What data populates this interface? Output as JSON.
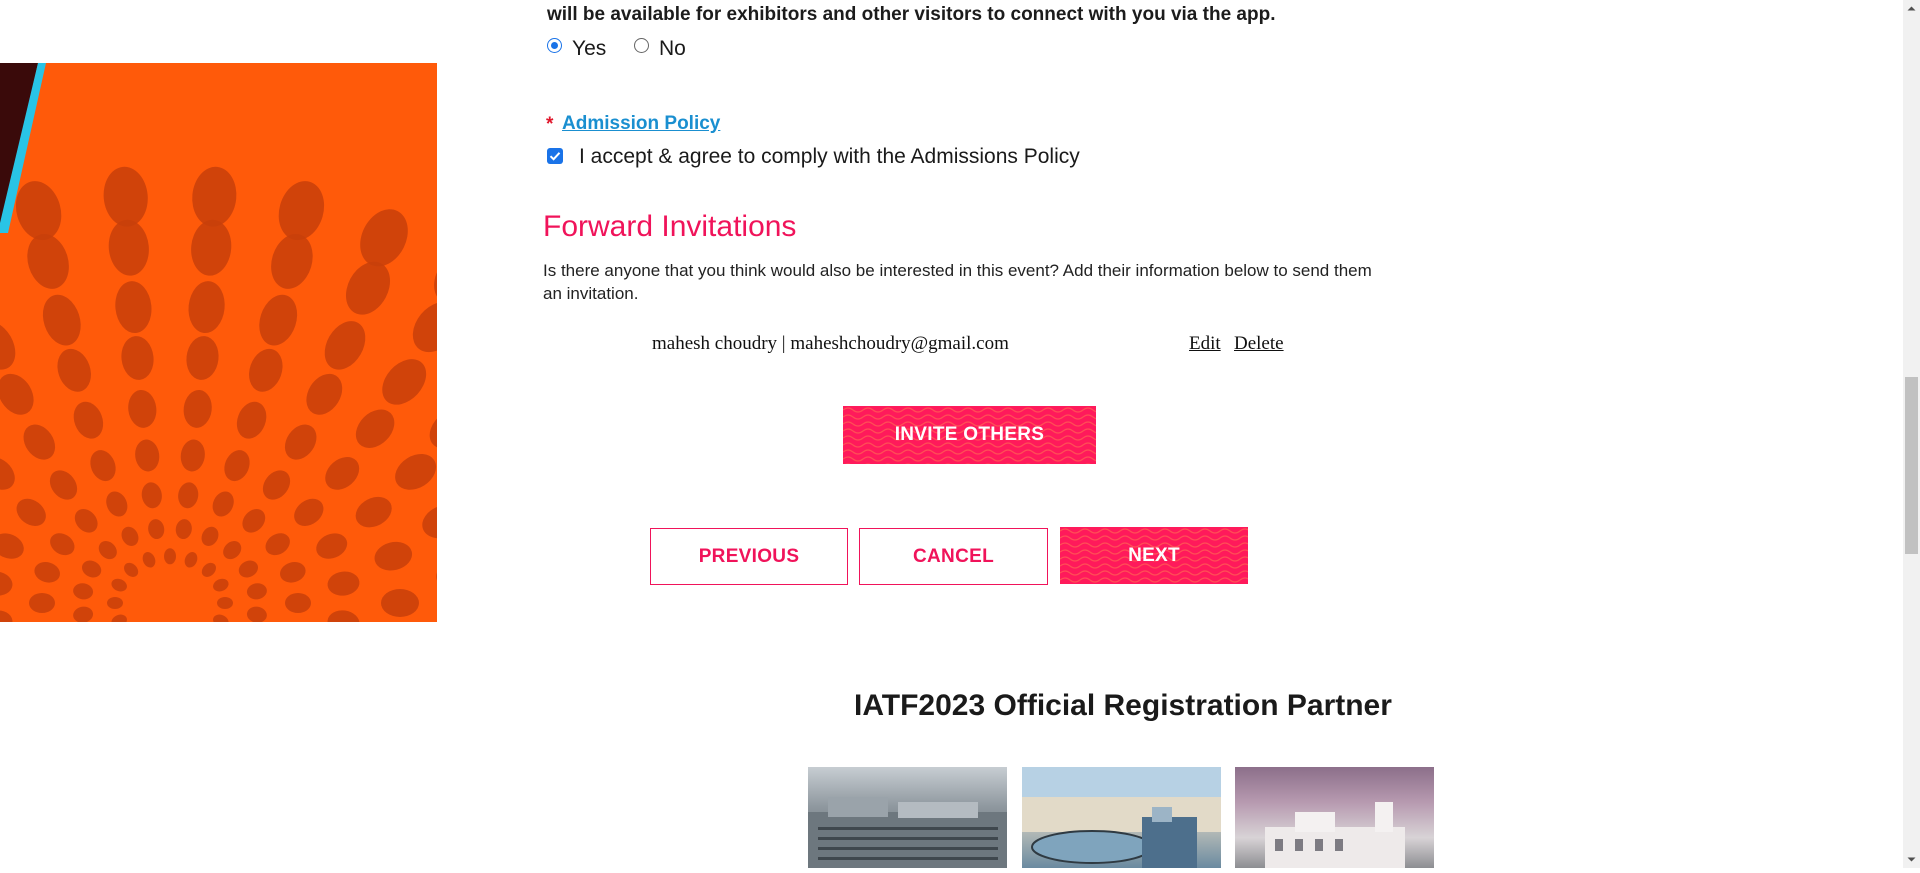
{
  "form": {
    "top_note": "will be available for exhibitors and other visitors to connect with you via the app.",
    "connect_options": [
      "Yes",
      "No"
    ],
    "connect_selected": "Yes",
    "admission": {
      "required_marker": "*",
      "link_label": "Admission Policy",
      "accept_label": "I accept & agree to comply with the Admissions Policy",
      "accepted": true
    }
  },
  "forward": {
    "heading": "Forward Invitations",
    "description": "Is there anyone that you think would also be interested in this event? Add their information below to send them an invitation.",
    "invitees": [
      {
        "display": "mahesh choudry | maheshchoudry@gmail.com",
        "edit_label": "Edit",
        "delete_label": "Delete"
      }
    ],
    "invite_button": "INVITE OTHERS"
  },
  "nav": {
    "previous": "PREVIOUS",
    "cancel": "CANCEL",
    "next": "NEXT"
  },
  "partner": {
    "title": "IATF2023 Official Registration Partner"
  },
  "colors": {
    "accent_pink": "#ff1a5b",
    "heading_pink": "#f0135a",
    "link_blue": "#1a8fd0",
    "art_orange": "#ff5a0a"
  }
}
